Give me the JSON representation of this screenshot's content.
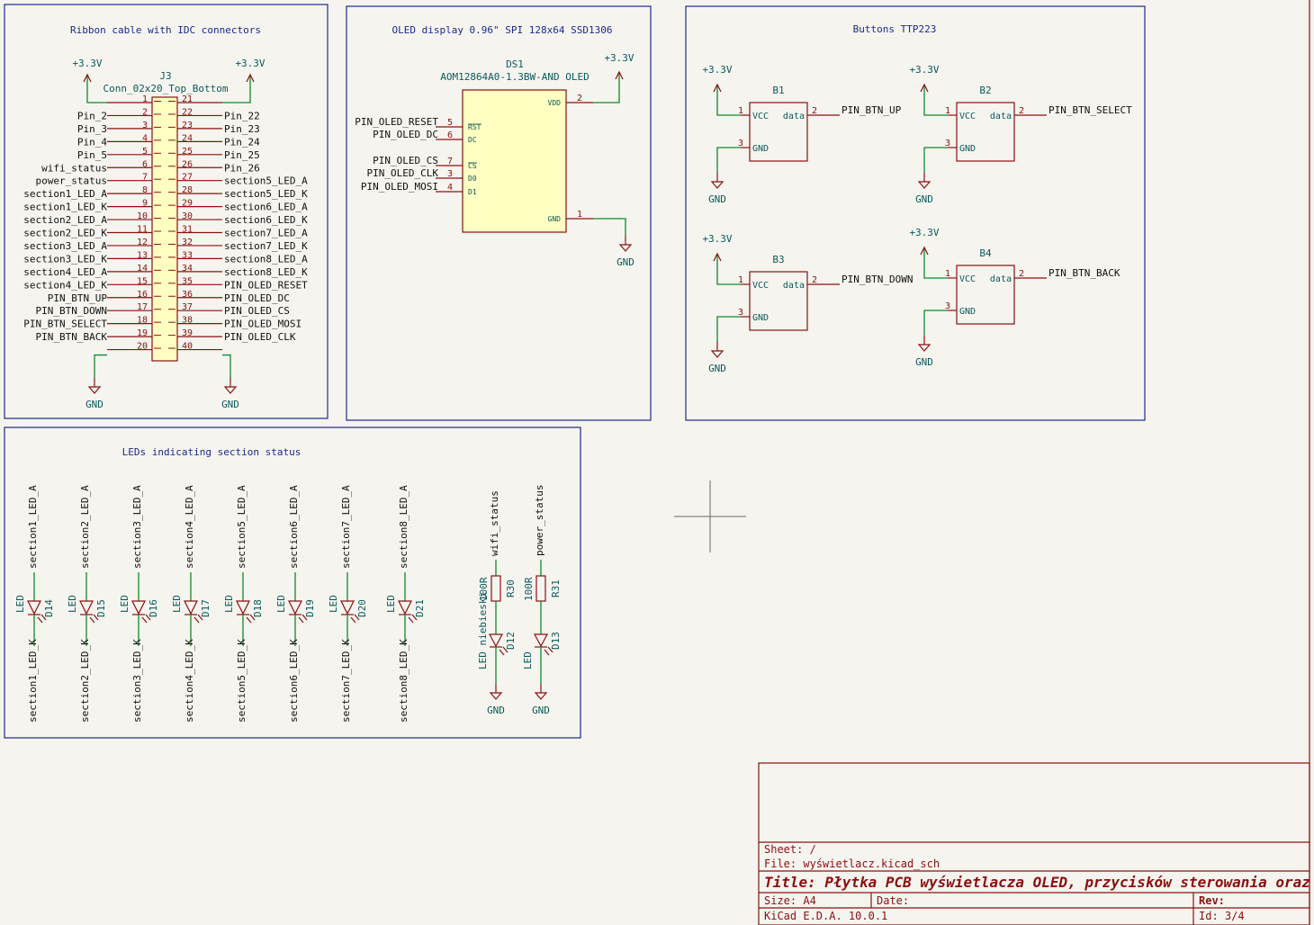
{
  "frames": {
    "ribbon": "Ribbon cable with IDC connectors",
    "oled": "OLED display 0.96\" SPI 128x64 SSD1306",
    "buttons": "Buttons TTP223",
    "leds": "LEDs indicating section status"
  },
  "j3": {
    "ref": "J3",
    "value": "Conn_02x20_Top_Bottom",
    "left_nets": [
      "",
      "Pin_2",
      "Pin_3",
      "Pin_4",
      "Pin_5",
      "wifi_status",
      "power_status",
      "section1_LED_A",
      "section1_LED_K",
      "section2_LED_A",
      "section2_LED_K",
      "section3_LED_A",
      "section3_LED_K",
      "section4_LED_A",
      "section4_LED_K",
      "PIN_BTN_UP",
      "PIN_BTN_DOWN",
      "PIN_BTN_SELECT",
      "PIN_BTN_BACK",
      ""
    ],
    "right_nets": [
      "",
      "Pin_22",
      "Pin_23",
      "Pin_24",
      "Pin_25",
      "Pin_26",
      "section5_LED_A",
      "section5_LED_K",
      "section6_LED_A",
      "section6_LED_K",
      "section7_LED_A",
      "section7_LED_K",
      "section8_LED_A",
      "section8_LED_K",
      "PIN_OLED_RESET",
      "PIN_OLED_DC",
      "PIN_OLED_CS",
      "PIN_OLED_MOSI",
      "PIN_OLED_CLK",
      ""
    ],
    "left_pins": [
      "1",
      "2",
      "3",
      "4",
      "5",
      "6",
      "7",
      "8",
      "9",
      "10",
      "11",
      "12",
      "13",
      "14",
      "15",
      "16",
      "17",
      "18",
      "19",
      "20"
    ],
    "right_pins": [
      "21",
      "22",
      "23",
      "24",
      "25",
      "26",
      "27",
      "28",
      "29",
      "30",
      "31",
      "32",
      "33",
      "34",
      "35",
      "36",
      "37",
      "38",
      "39",
      "40"
    ]
  },
  "power": {
    "vcc": "+3.3V",
    "gnd": "GND"
  },
  "ds1": {
    "ref": "DS1",
    "value": "AOM12864A0-1.3BW-AND OLED",
    "pins_left": [
      {
        "net": "PIN_OLED_RESET",
        "num": "5",
        "name": "RST"
      },
      {
        "net": "PIN_OLED_DC",
        "num": "6",
        "name": "DC"
      },
      {
        "net": "PIN_OLED_CS",
        "num": "7",
        "name": "CS"
      },
      {
        "net": "PIN_OLED_CLK",
        "num": "3",
        "name": "D0"
      },
      {
        "net": "PIN_OLED_MOSI",
        "num": "4",
        "name": "D1"
      }
    ],
    "vdd": {
      "num": "2",
      "name": "VDD"
    },
    "gnd": {
      "num": "1",
      "name": "GND"
    }
  },
  "buttons": [
    {
      "ref": "B1",
      "net": "PIN_BTN_UP"
    },
    {
      "ref": "B2",
      "net": "PIN_BTN_SELECT"
    },
    {
      "ref": "B3",
      "net": "PIN_BTN_DOWN"
    },
    {
      "ref": "B4",
      "net": "PIN_BTN_BACK"
    }
  ],
  "button_pins": {
    "vcc": "VCC",
    "gnd": "GND",
    "data": "data",
    "n1": "1",
    "n2": "2",
    "n3": "3"
  },
  "leds": [
    {
      "ref": "D14",
      "value": "LED",
      "a": "section1_LED_A",
      "k": "section1_LED_K"
    },
    {
      "ref": "D15",
      "value": "LED",
      "a": "section2_LED_A",
      "k": "section2_LED_K"
    },
    {
      "ref": "D16",
      "value": "LED",
      "a": "section3_LED_A",
      "k": "section3_LED_K"
    },
    {
      "ref": "D17",
      "value": "LED",
      "a": "section4_LED_A",
      "k": "section4_LED_K"
    },
    {
      "ref": "D18",
      "value": "LED",
      "a": "section5_LED_A",
      "k": "section5_LED_K"
    },
    {
      "ref": "D19",
      "value": "LED",
      "a": "section6_LED_A",
      "k": "section6_LED_K"
    },
    {
      "ref": "D20",
      "value": "LED",
      "a": "section7_LED_A",
      "k": "section7_LED_K"
    },
    {
      "ref": "D21",
      "value": "LED",
      "a": "section8_LED_A",
      "k": "section8_LED_K"
    }
  ],
  "status_leds": [
    {
      "net": "wifi_status",
      "r_ref": "R30",
      "r_val": "100R",
      "d_ref": "D12",
      "d_val": "LED niebieski"
    },
    {
      "net": "power_status",
      "r_ref": "R31",
      "r_val": "100R",
      "d_ref": "D13",
      "d_val": "LED"
    }
  ],
  "title_block": {
    "sheet": "Sheet: /",
    "file": "File: wyświetlacz.kicad_sch",
    "title": "Title: Płytka PCB wyświetlacza OLED, przycisków sterowania oraz LED",
    "size": "Size: A4",
    "date": "Date:",
    "rev": "Rev:",
    "tool": "KiCad E.D.A. 10.0.1",
    "id": "Id: 3/4"
  }
}
